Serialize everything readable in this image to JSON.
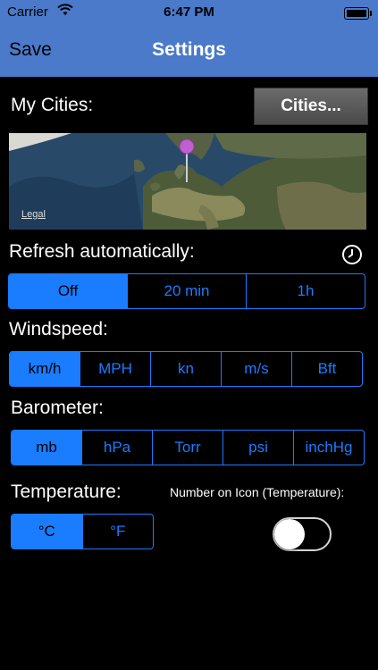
{
  "status_bar": {
    "carrier": "Carrier",
    "time": "6:47 PM"
  },
  "nav": {
    "save": "Save",
    "title": "Settings"
  },
  "my_cities": {
    "label": "My Cities:",
    "button": "Cities..."
  },
  "map": {
    "legal": "Legal"
  },
  "refresh": {
    "label": "Refresh automatically:",
    "options": [
      "Off",
      "20 min",
      "1h"
    ],
    "selected": "Off"
  },
  "windspeed": {
    "label": "Windspeed:",
    "options": [
      "km/h",
      "MPH",
      "kn",
      "m/s",
      "Bft"
    ],
    "selected": "km/h"
  },
  "barometer": {
    "label": "Barometer:",
    "options": [
      "mb",
      "hPa",
      "Torr",
      "psi",
      "inchHg"
    ],
    "selected": "mb"
  },
  "temperature": {
    "label": "Temperature:",
    "options": [
      "°C",
      "°F"
    ],
    "selected": "°C"
  },
  "icon_number": {
    "label": "Number on Icon (Temperature):",
    "on": false
  },
  "colors": {
    "accent": "#1a7cff",
    "nav_bg": "#4a7ac9",
    "background": "#000000",
    "pin": "#c060d0"
  }
}
